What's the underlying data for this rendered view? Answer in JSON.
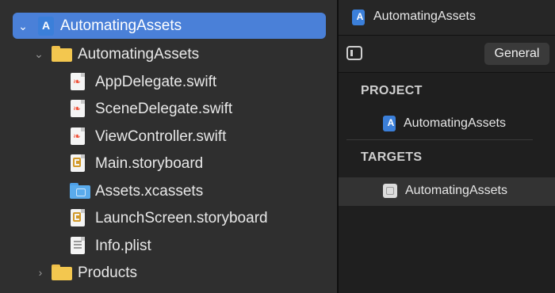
{
  "navigator": {
    "items": [
      {
        "label": "AutomatingAssets",
        "icon": "project-icon",
        "expanded": true,
        "selected": true
      },
      {
        "label": "AutomatingAssets",
        "icon": "folder-icon",
        "expanded": true
      },
      {
        "label": "AppDelegate.swift",
        "icon": "swift-file-icon"
      },
      {
        "label": "SceneDelegate.swift",
        "icon": "swift-file-icon"
      },
      {
        "label": "ViewController.swift",
        "icon": "swift-file-icon"
      },
      {
        "label": "Main.storyboard",
        "icon": "storyboard-file-icon"
      },
      {
        "label": "Assets.xcassets",
        "icon": "asset-catalog-icon"
      },
      {
        "label": "LaunchScreen.storyboard",
        "icon": "storyboard-file-icon"
      },
      {
        "label": "Info.plist",
        "icon": "plist-file-icon"
      },
      {
        "label": "Products",
        "icon": "folder-icon",
        "expanded": false
      }
    ]
  },
  "editor": {
    "title": "AutomatingAssets",
    "general_tab": "General",
    "project_header": "PROJECT",
    "project_item": "AutomatingAssets",
    "targets_header": "TARGETS",
    "target_item": "AutomatingAssets"
  },
  "colors": {
    "selection": "#4a80d8",
    "folder": "#f3c74f",
    "swift": "#f05138"
  }
}
